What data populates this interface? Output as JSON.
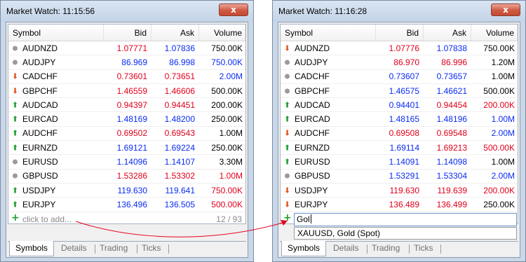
{
  "columns": {
    "symbol": "Symbol",
    "bid": "Bid",
    "ask": "Ask",
    "volume": "Volume"
  },
  "tabs": [
    "Symbols",
    "Details",
    "Trading",
    "Ticks"
  ],
  "close_symbol": "x",
  "colors": {
    "up": "#e0001b",
    "down": "#0b2cf0",
    "neutral": "#000000",
    "arrow": "#e8001a"
  },
  "left": {
    "title": "Market Watch: 11:15:56",
    "rows": [
      {
        "icon": "neutral-dot-icon",
        "symbol": "AUDNZD",
        "bid": "1.07771",
        "bid_c": "red",
        "ask": "1.07836",
        "ask_c": "blue",
        "volume": "750.00K",
        "vol_c": "black"
      },
      {
        "icon": "neutral-dot-icon",
        "symbol": "AUDJPY",
        "bid": "86.969",
        "bid_c": "blue",
        "ask": "86.998",
        "ask_c": "blue",
        "volume": "750.00K",
        "vol_c": "blue"
      },
      {
        "icon": "down-arrow-icon",
        "symbol": "CADCHF",
        "bid": "0.73601",
        "bid_c": "red",
        "ask": "0.73651",
        "ask_c": "red",
        "volume": "2.00M",
        "vol_c": "blue"
      },
      {
        "icon": "down-arrow-icon",
        "symbol": "GBPCHF",
        "bid": "1.46559",
        "bid_c": "red",
        "ask": "1.46606",
        "ask_c": "red",
        "volume": "500.00K",
        "vol_c": "black"
      },
      {
        "icon": "up-arrow-icon",
        "symbol": "AUDCAD",
        "bid": "0.94397",
        "bid_c": "red",
        "ask": "0.94451",
        "ask_c": "red",
        "volume": "200.00K",
        "vol_c": "black"
      },
      {
        "icon": "up-arrow-icon",
        "symbol": "EURCAD",
        "bid": "1.48169",
        "bid_c": "blue",
        "ask": "1.48200",
        "ask_c": "blue",
        "volume": "250.00K",
        "vol_c": "black"
      },
      {
        "icon": "up-arrow-icon",
        "symbol": "AUDCHF",
        "bid": "0.69502",
        "bid_c": "red",
        "ask": "0.69543",
        "ask_c": "red",
        "volume": "1.00M",
        "vol_c": "black"
      },
      {
        "icon": "up-arrow-icon",
        "symbol": "EURNZD",
        "bid": "1.69121",
        "bid_c": "blue",
        "ask": "1.69224",
        "ask_c": "blue",
        "volume": "250.00K",
        "vol_c": "black"
      },
      {
        "icon": "neutral-dot-icon",
        "symbol": "EURUSD",
        "bid": "1.14096",
        "bid_c": "blue",
        "ask": "1.14107",
        "ask_c": "blue",
        "volume": "3.30M",
        "vol_c": "black"
      },
      {
        "icon": "neutral-dot-icon",
        "symbol": "GBPUSD",
        "bid": "1.53286",
        "bid_c": "red",
        "ask": "1.53302",
        "ask_c": "red",
        "volume": "1.00M",
        "vol_c": "red"
      },
      {
        "icon": "up-arrow-icon",
        "symbol": "USDJPY",
        "bid": "119.630",
        "bid_c": "blue",
        "ask": "119.641",
        "ask_c": "blue",
        "volume": "750.00K",
        "vol_c": "red"
      },
      {
        "icon": "up-arrow-icon",
        "symbol": "EURJPY",
        "bid": "136.496",
        "bid_c": "blue",
        "ask": "136.505",
        "ask_c": "blue",
        "volume": "500.00K",
        "vol_c": "red"
      }
    ],
    "add_text": "click to add...",
    "count": "12 / 93"
  },
  "right": {
    "title": "Market Watch: 11:16:28",
    "rows": [
      {
        "icon": "down-arrow-icon",
        "symbol": "AUDNZD",
        "bid": "1.07776",
        "bid_c": "red",
        "ask": "1.07838",
        "ask_c": "blue",
        "volume": "750.00K",
        "vol_c": "black"
      },
      {
        "icon": "neutral-dot-icon",
        "symbol": "AUDJPY",
        "bid": "86.970",
        "bid_c": "red",
        "ask": "86.996",
        "ask_c": "red",
        "volume": "1.20M",
        "vol_c": "black"
      },
      {
        "icon": "neutral-dot-icon",
        "symbol": "CADCHF",
        "bid": "0.73607",
        "bid_c": "blue",
        "ask": "0.73657",
        "ask_c": "blue",
        "volume": "1.00M",
        "vol_c": "black"
      },
      {
        "icon": "neutral-dot-icon",
        "symbol": "GBPCHF",
        "bid": "1.46575",
        "bid_c": "blue",
        "ask": "1.46621",
        "ask_c": "blue",
        "volume": "500.00K",
        "vol_c": "black"
      },
      {
        "icon": "up-arrow-icon",
        "symbol": "AUDCAD",
        "bid": "0.94401",
        "bid_c": "blue",
        "ask": "0.94454",
        "ask_c": "red",
        "volume": "200.00K",
        "vol_c": "red"
      },
      {
        "icon": "up-arrow-icon",
        "symbol": "EURCAD",
        "bid": "1.48165",
        "bid_c": "blue",
        "ask": "1.48196",
        "ask_c": "blue",
        "volume": "1.00M",
        "vol_c": "blue"
      },
      {
        "icon": "down-arrow-icon",
        "symbol": "AUDCHF",
        "bid": "0.69508",
        "bid_c": "red",
        "ask": "0.69548",
        "ask_c": "red",
        "volume": "2.00M",
        "vol_c": "blue"
      },
      {
        "icon": "up-arrow-icon",
        "symbol": "EURNZD",
        "bid": "1.69114",
        "bid_c": "blue",
        "ask": "1.69213",
        "ask_c": "red",
        "volume": "500.00K",
        "vol_c": "red"
      },
      {
        "icon": "up-arrow-icon",
        "symbol": "EURUSD",
        "bid": "1.14091",
        "bid_c": "blue",
        "ask": "1.14098",
        "ask_c": "blue",
        "volume": "1.00M",
        "vol_c": "black"
      },
      {
        "icon": "neutral-dot-icon",
        "symbol": "GBPUSD",
        "bid": "1.53291",
        "bid_c": "blue",
        "ask": "1.53304",
        "ask_c": "blue",
        "volume": "2.00M",
        "vol_c": "blue"
      },
      {
        "icon": "down-arrow-icon",
        "symbol": "USDJPY",
        "bid": "119.630",
        "bid_c": "red",
        "ask": "119.639",
        "ask_c": "red",
        "volume": "200.00K",
        "vol_c": "red"
      },
      {
        "icon": "down-arrow-icon",
        "symbol": "EURJPY",
        "bid": "136.489",
        "bid_c": "red",
        "ask": "136.499",
        "ask_c": "red",
        "volume": "250.00K",
        "vol_c": "black"
      }
    ],
    "search_value": "Gol",
    "suggestion": "XAUUSD, Gold (Spot)"
  }
}
